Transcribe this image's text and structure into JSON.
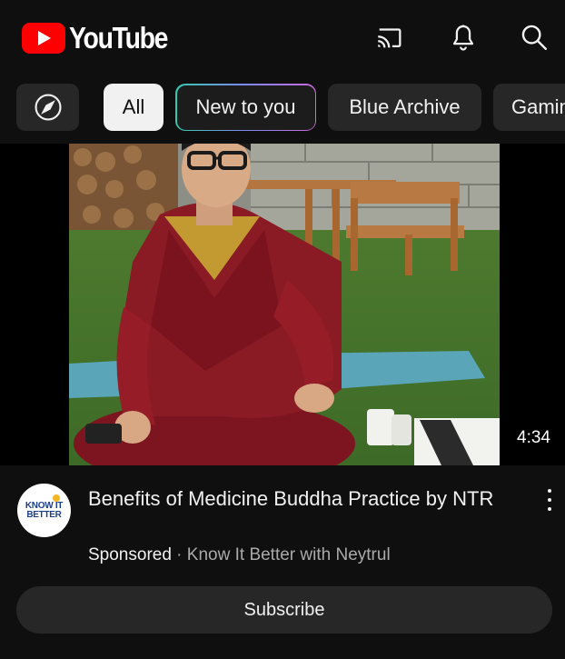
{
  "header": {
    "logo_text": "YouTube",
    "icons": [
      "cast-icon",
      "bell-icon",
      "search-icon"
    ]
  },
  "chips": {
    "explore_icon": "compass-icon",
    "items": [
      "All",
      "New to you",
      "Blue Archive",
      "Gaming"
    ],
    "selected": "All"
  },
  "video": {
    "duration": "4:34",
    "title": "Benefits of Medicine Buddha Practice by NTR",
    "sponsored": "Sponsored",
    "separator": " · ",
    "channel": "Know It Better with Neytrul",
    "avatar_line1": "KNOW IT",
    "avatar_line2": "BETTER",
    "subscribe_label": "Subscribe"
  },
  "colors": {
    "background": "#0f0f0f",
    "brand_red": "#ff0000",
    "chip_bg": "#272727",
    "chip_selected_bg": "#f1f1f1"
  }
}
